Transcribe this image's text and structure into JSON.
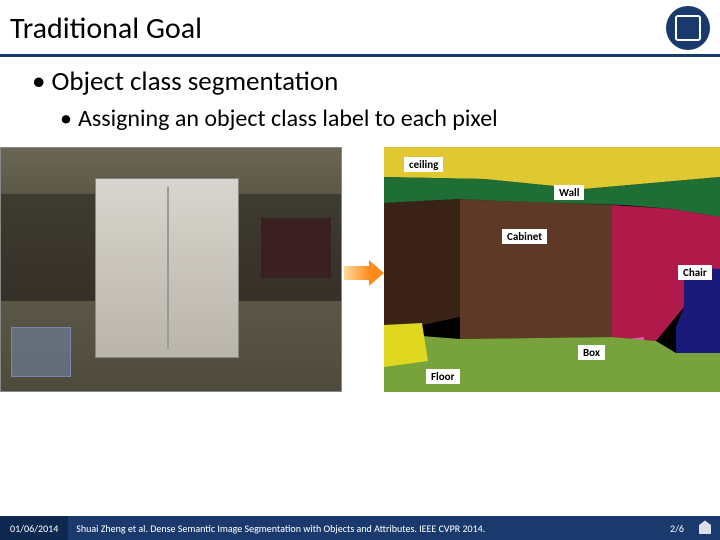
{
  "title": "Traditional Goal",
  "bullets": {
    "l1": "Object class segmentation",
    "l2": "Assigning an object class label to each pixel"
  },
  "seg_labels": {
    "ceiling": "ceiling",
    "wall": "Wall",
    "cabinet": "Cabinet",
    "chair": "Chair",
    "box": "Box",
    "floor": "Floor"
  },
  "footer": {
    "date": "01/06/2014",
    "citation": "Shuai Zheng et al. Dense Semantic Image Segmentation with Objects and Attributes. IEEE CVPR 2014.",
    "page": "2/6"
  }
}
